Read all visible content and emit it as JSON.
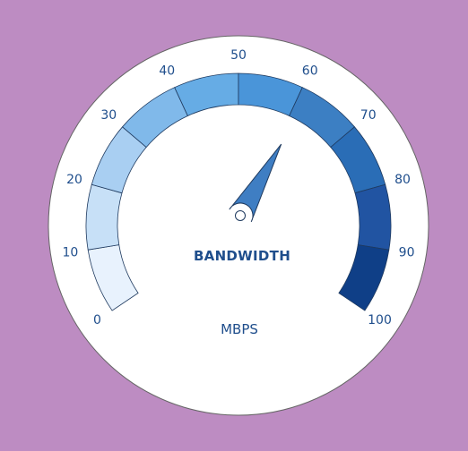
{
  "chart_data": {
    "type": "gauge",
    "title": "BANDWIDTH",
    "unit": "MBPS",
    "min": 0,
    "max": 100,
    "value": 62,
    "ticks": [
      "0",
      "10",
      "20",
      "30",
      "40",
      "50",
      "60",
      "70",
      "80",
      "90",
      "100"
    ],
    "band_colors": [
      "#e8f2fd",
      "#c7e0f7",
      "#a9cff2",
      "#80b9ea",
      "#66ace5",
      "#4a95d9",
      "#3c7fc3",
      "#2a6db6",
      "#2154a2",
      "#0f3f87",
      "#1c2d5d"
    ],
    "needle_color": "#3f7ec3",
    "face_color": "#ffffff",
    "background_color": "#bd8cc2"
  }
}
